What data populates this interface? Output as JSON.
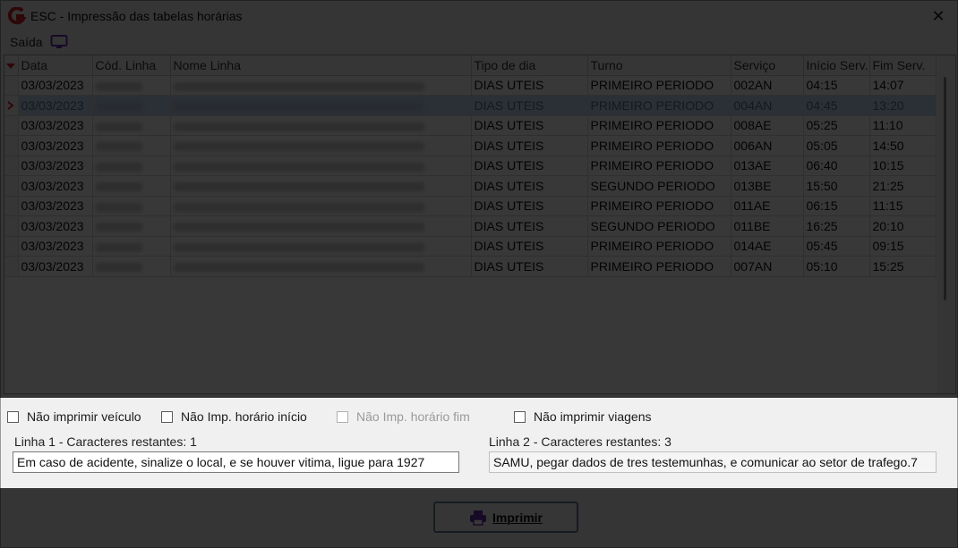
{
  "window": {
    "title": "ESC - Impressão das tabelas horárias",
    "close_glyph": "✕"
  },
  "menu": {
    "exit_label": "Saída",
    "monitor_icon": "monitor-icon"
  },
  "grid": {
    "columns": [
      "Data",
      "Cód. Linha",
      "Nome Linha",
      "Tipo de dia",
      "Turno",
      "Serviço",
      "Início Serv.",
      "Fim Serv."
    ],
    "rows": [
      [
        "03/03/2023",
        "",
        "",
        "DIAS UTEIS",
        "PRIMEIRO PERIODO",
        "002AN",
        "04:15",
        "14:07"
      ],
      [
        "03/03/2023",
        "",
        "",
        "DIAS UTEIS",
        "PRIMEIRO PERIODO",
        "004AN",
        "04:45",
        "13:20"
      ],
      [
        "03/03/2023",
        "",
        "",
        "DIAS UTEIS",
        "PRIMEIRO PERIODO",
        "008AE",
        "05:25",
        "11:10"
      ],
      [
        "03/03/2023",
        "",
        "",
        "DIAS UTEIS",
        "PRIMEIRO PERIODO",
        "006AN",
        "05:05",
        "14:50"
      ],
      [
        "03/03/2023",
        "",
        "",
        "DIAS UTEIS",
        "PRIMEIRO PERIODO",
        "013AE",
        "06:40",
        "10:15"
      ],
      [
        "03/03/2023",
        "",
        "",
        "DIAS UTEIS",
        "SEGUNDO PERIODO",
        "013BE",
        "15:50",
        "21:25"
      ],
      [
        "03/03/2023",
        "",
        "",
        "DIAS UTEIS",
        "PRIMEIRO PERIODO",
        "011AE",
        "06:15",
        "11:15"
      ],
      [
        "03/03/2023",
        "",
        "",
        "DIAS UTEIS",
        "SEGUNDO PERIODO",
        "011BE",
        "16:25",
        "20:10"
      ],
      [
        "03/03/2023",
        "",
        "",
        "DIAS UTEIS",
        "PRIMEIRO PERIODO",
        "014AE",
        "05:45",
        "09:15"
      ],
      [
        "03/03/2023",
        "",
        "",
        "DIAS UTEIS",
        "PRIMEIRO PERIODO",
        "007AN",
        "05:10",
        "15:25"
      ]
    ],
    "selected_row": 1
  },
  "options": {
    "no_print_vehicle": "Não imprimir veículo",
    "no_print_start_time": "Não Imp. horário início",
    "no_print_end_time": "Não Imp. horário fim",
    "no_print_trips": "Não imprimir viagens",
    "line1_label": "Linha 1 - Caracteres restantes: 1",
    "line1_value": "Em caso de acidente, sinalize o local, e se houver vitima, ligue para 1927",
    "line2_label": "Linha 2 - Caracteres restantes: 3",
    "line2_value": "SAMU, pegar dados de tres testemunhas, e comunicar ao setor de trafego.7"
  },
  "footer": {
    "print_label": "Imprimir",
    "print_icon": "printer-icon"
  },
  "colors": {
    "accent": "#6b2fb3",
    "logo_red": "#d0202a",
    "selection": "#c5d8f3",
    "indicator": "#d0202a"
  }
}
